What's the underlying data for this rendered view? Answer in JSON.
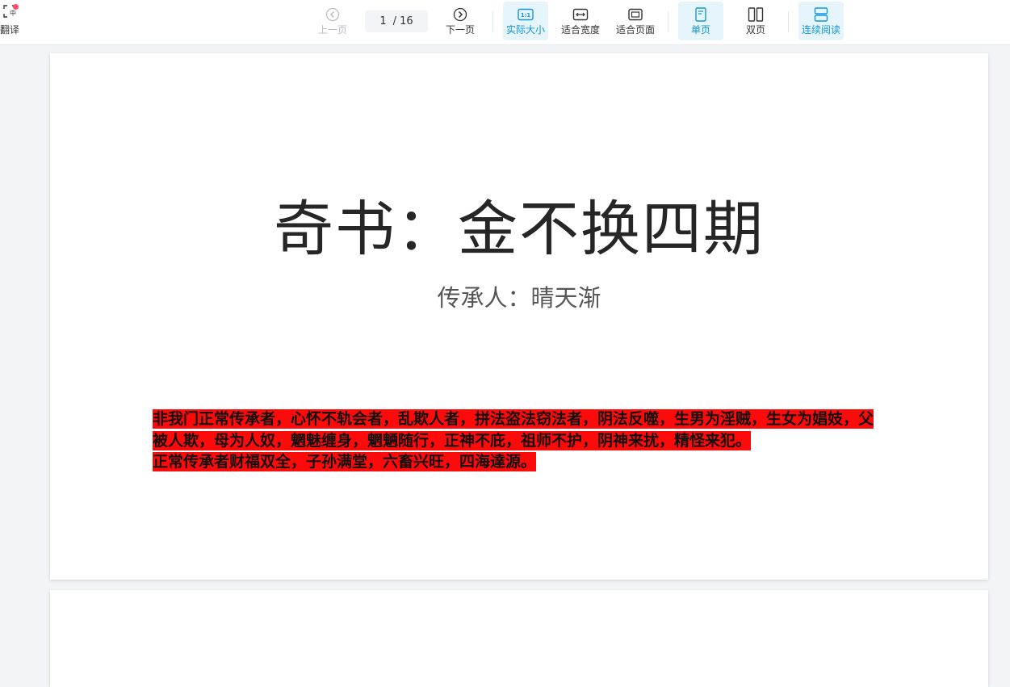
{
  "toolbar": {
    "translate_label": "翻译",
    "prev_label": "上一页",
    "next_label": "下一页",
    "page_current": "1",
    "page_total": "/ 16",
    "actual_size_label": "实际大小",
    "fit_width_label": "适合宽度",
    "fit_page_label": "适合页面",
    "single_page_label": "单页",
    "double_page_label": "双页",
    "continuous_label": "连续阅读"
  },
  "document": {
    "title": "奇书：金不换四期",
    "subtitle": "传承人：晴天渐",
    "paragraph1": "非我门正常传承者，心怀不轨会者，乱欺人者，拼法盗法窃法者，阴法反噬，生男为淫贼，生女为娼妓，父被人欺，母为人奴，魍魅缠身，魍魉随行，正神不庇，祖师不护，阴神来扰，精怪来犯。",
    "paragraph2": "正常传承者财福双全，子孙满堂，六畜兴旺，四海達源。"
  },
  "colors": {
    "accent": "#1296db",
    "active_bg": "#e6f4fb",
    "highlight": "#ff0a0a",
    "notification_dot": "#ff4d6a"
  },
  "icons": {
    "translate": "scan-translate-icon",
    "prev": "circle-arrow-left-icon",
    "next": "circle-arrow-right-icon",
    "actual_size": "one-to-one-icon",
    "fit_width": "fit-width-icon",
    "fit_page": "fit-page-icon",
    "single_page": "single-page-icon",
    "double_page": "double-page-icon",
    "continuous": "continuous-scroll-icon"
  }
}
